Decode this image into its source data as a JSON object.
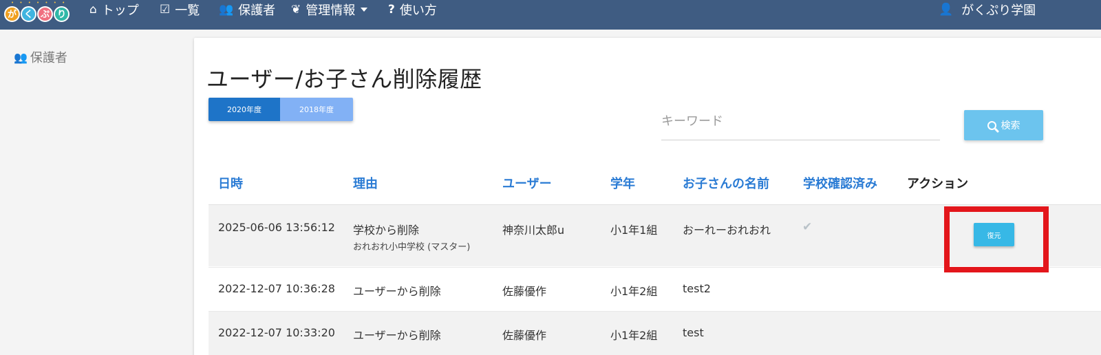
{
  "logo": {
    "letters": [
      "が",
      "く",
      "ぷ",
      "り"
    ],
    "colors": [
      "#f0a020",
      "#40b4e0",
      "#f07080",
      "#30b8a8"
    ]
  },
  "nav": {
    "top": {
      "icon": "home-icon",
      "label": "トップ"
    },
    "list": {
      "icon": "calendar-check-icon",
      "label": "一覧"
    },
    "guardians": {
      "icon": "users-icon",
      "label": "保護者"
    },
    "admin": {
      "icon": "leaf-icon",
      "label": "管理情報"
    },
    "help": {
      "icon": "question-icon",
      "label": "使い方"
    },
    "user": {
      "icon": "user-icon",
      "label": "がくぷり学園"
    }
  },
  "sidebar": {
    "icon": "users-icon",
    "title": "保護者"
  },
  "page": {
    "title": "ユーザー/お子さん削除履歴",
    "years": [
      "2020年度",
      "2018年度"
    ],
    "keyword_placeholder": "キーワード",
    "search_label": "検索"
  },
  "table": {
    "headers": [
      "日時",
      "理由",
      "ユーザー",
      "学年",
      "お子さんの名前",
      "学校確認済み",
      "アクション"
    ],
    "rows": [
      {
        "datetime": "2025-06-06 13:56:12",
        "reason": "学校から削除",
        "reason_sub": "おれおれ小中学校 (マスター)",
        "user": "神奈川太郎u",
        "grade": "小1年1組",
        "child": "おーれーおれおれ",
        "school_confirmed": true,
        "action": "復元"
      },
      {
        "datetime": "2022-12-07 10:36:28",
        "reason": "ユーザーから削除",
        "user": "佐藤優作",
        "grade": "小1年2組",
        "child": "test2"
      },
      {
        "datetime": "2022-12-07 10:33:20",
        "reason": "ユーザーから削除",
        "user": "佐藤優作",
        "grade": "小1年2組",
        "child": "test"
      }
    ]
  },
  "colors": {
    "navbar": "#3f5c82",
    "link": "#2a7bd4",
    "highlight": "#e3161b",
    "restore": "#37b8e6"
  }
}
